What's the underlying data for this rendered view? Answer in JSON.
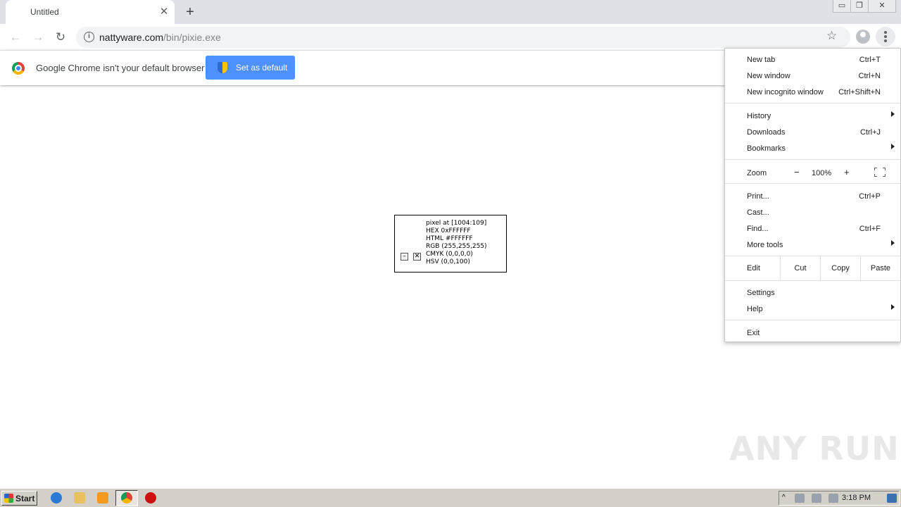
{
  "tab": {
    "title": "Untitled",
    "close": "✕",
    "new": "+"
  },
  "window": {
    "minimize": "▭",
    "restore": "❐",
    "close": "✕"
  },
  "nav": {
    "back": "←",
    "forward": "→",
    "reload": "↻"
  },
  "omnibox": {
    "domain": "nattyware.com",
    "path": "/bin/pixie.exe",
    "info": "i",
    "star": "☆"
  },
  "infobar": {
    "message": "Google Chrome isn't your default browser",
    "button": "Set as default"
  },
  "pixie": {
    "lines": [
      "pixel at [1004:109]",
      "HEX 0xFFFFFF",
      "HTML #FFFFFF",
      "RGB (255,255,255)",
      "CMYK (0,0,0,0)",
      "HSV (0,0,100)"
    ],
    "minimize": "–",
    "close": "✕"
  },
  "menu": {
    "new_tab": {
      "label": "New tab",
      "shortcut": "Ctrl+T"
    },
    "new_window": {
      "label": "New window",
      "shortcut": "Ctrl+N"
    },
    "new_incognito": {
      "label": "New incognito window",
      "shortcut": "Ctrl+Shift+N"
    },
    "history": {
      "label": "History"
    },
    "downloads": {
      "label": "Downloads",
      "shortcut": "Ctrl+J"
    },
    "bookmarks": {
      "label": "Bookmarks"
    },
    "zoom": {
      "label": "Zoom",
      "minus": "−",
      "level": "100%",
      "plus": "+"
    },
    "print": {
      "label": "Print...",
      "shortcut": "Ctrl+P"
    },
    "cast": {
      "label": "Cast..."
    },
    "find": {
      "label": "Find...",
      "shortcut": "Ctrl+F"
    },
    "more_tools": {
      "label": "More tools"
    },
    "edit": {
      "label": "Edit",
      "cut": "Cut",
      "copy": "Copy",
      "paste": "Paste"
    },
    "settings": {
      "label": "Settings"
    },
    "help": {
      "label": "Help"
    },
    "exit": {
      "label": "Exit"
    }
  },
  "watermark": "ANY RUN",
  "taskbar": {
    "start": "Start",
    "clock": "3:18 PM"
  },
  "colors": {
    "accent": "#4d90fe",
    "taskbar": "#d4d0c8",
    "tabstrip": "#dee1e6"
  }
}
